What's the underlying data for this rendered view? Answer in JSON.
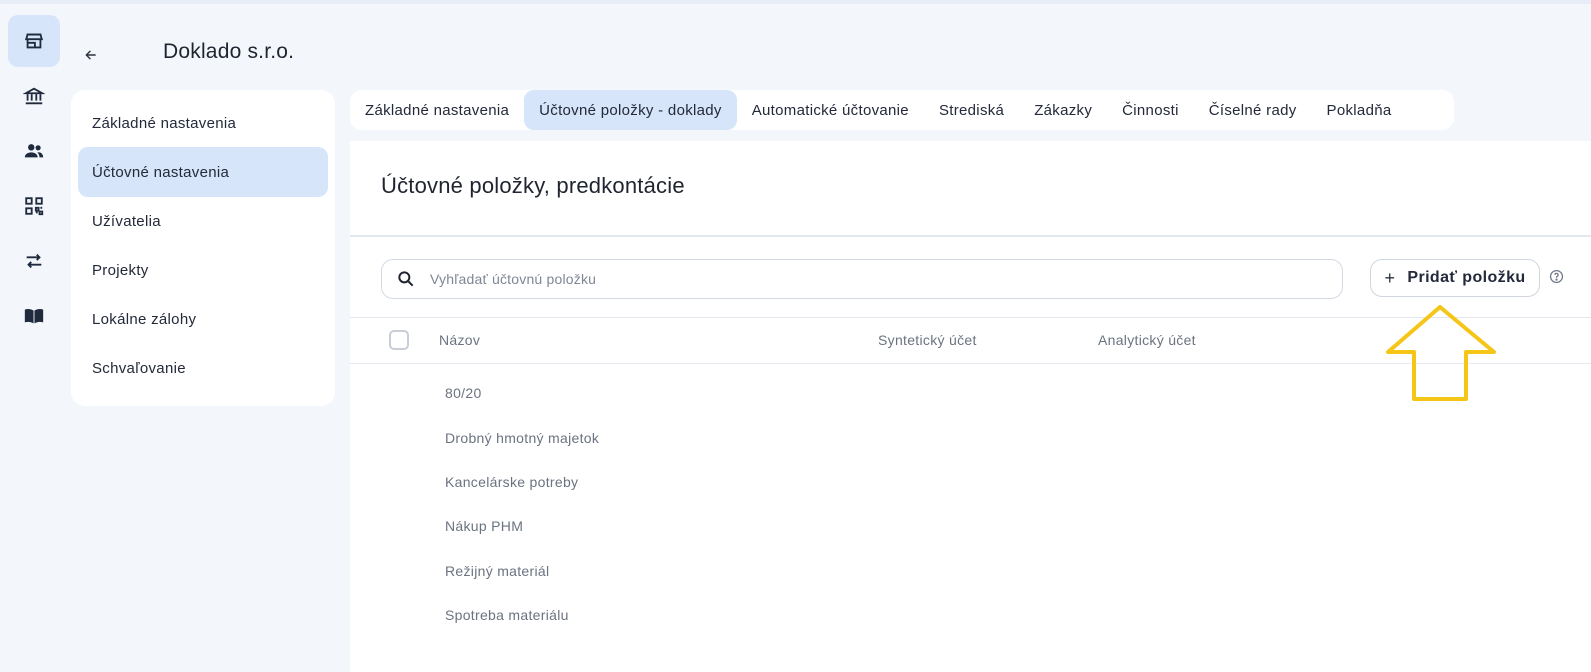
{
  "rail": {
    "items": [
      {
        "icon": "store-icon",
        "active": true
      },
      {
        "icon": "bank-icon",
        "active": false
      },
      {
        "icon": "users-icon",
        "active": false
      },
      {
        "icon": "qr-code-icon",
        "active": false
      },
      {
        "icon": "transfer-icon",
        "active": false
      },
      {
        "icon": "book-icon",
        "active": false
      }
    ]
  },
  "header": {
    "company_name": "Doklado s.r.o."
  },
  "settings_menu": {
    "items": [
      {
        "label": "Základné nastavenia"
      },
      {
        "label": "Účtovné nastavenia"
      },
      {
        "label": "Užívatelia"
      },
      {
        "label": "Projekty"
      },
      {
        "label": "Lokálne zálohy"
      },
      {
        "label": "Schvaľovanie"
      }
    ],
    "active_index": 1
  },
  "tabs": [
    {
      "label": "Základné nastavenia"
    },
    {
      "label": "Účtovné položky - doklady"
    },
    {
      "label": "Automatické účtovanie"
    },
    {
      "label": "Strediská"
    },
    {
      "label": "Zákazky"
    },
    {
      "label": "Činnosti"
    },
    {
      "label": "Číselné rady"
    },
    {
      "label": "Pokladňa"
    }
  ],
  "active_tab_index": 1,
  "main": {
    "title": "Účtovné položky, predkontácie",
    "search": {
      "placeholder": "Vyhľadať účtovnú položku",
      "value": ""
    },
    "add_button_label": "Pridať položku",
    "table": {
      "columns": [
        "Názov",
        "Syntetický účet",
        "Analytický účet"
      ],
      "rows": [
        {
          "name": "80/20",
          "synthetic": "",
          "analytic": ""
        },
        {
          "name": "Drobný hmotný majetok",
          "synthetic": "",
          "analytic": ""
        },
        {
          "name": "Kancelárske potreby",
          "synthetic": "",
          "analytic": ""
        },
        {
          "name": "Nákup PHM",
          "synthetic": "",
          "analytic": ""
        },
        {
          "name": "Režijný materiál",
          "synthetic": "",
          "analytic": ""
        },
        {
          "name": "Spotreba materiálu",
          "synthetic": "",
          "analytic": ""
        }
      ]
    }
  },
  "annotation": {
    "icon": "up-arrow-highlight-icon",
    "color": "#f5c518"
  },
  "colors": {
    "accent_bg": "#d6e5f9",
    "page_bg": "#f3f7fc"
  }
}
